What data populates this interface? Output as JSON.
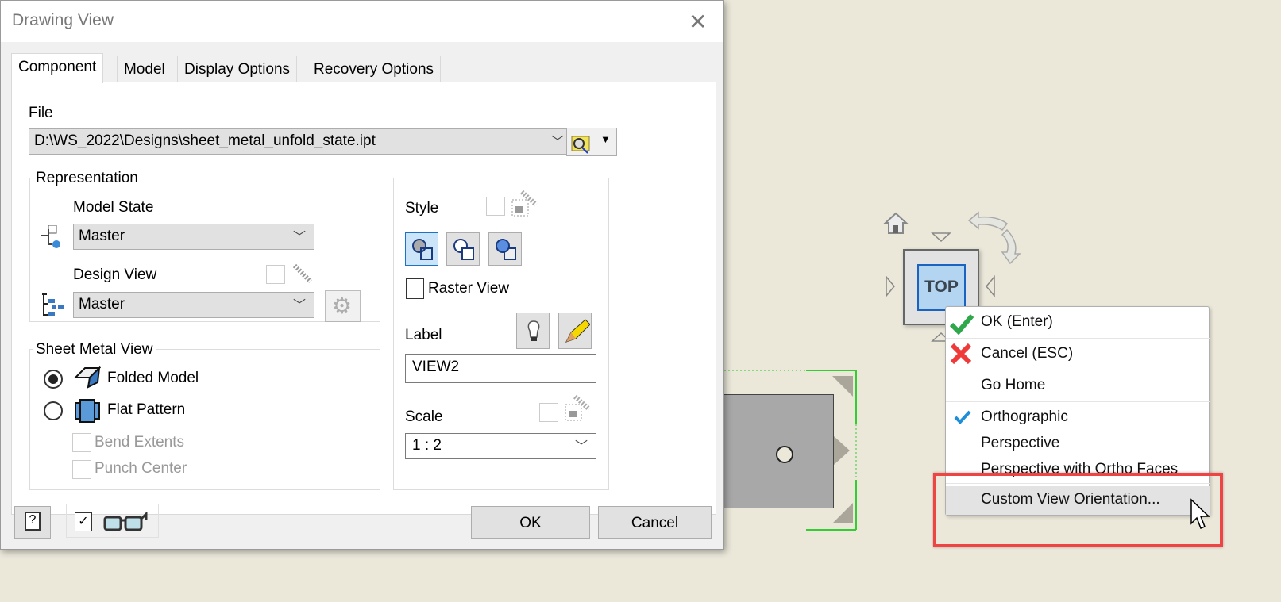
{
  "dialog": {
    "title": "Drawing View",
    "close": "✕",
    "tabs": [
      "Component",
      "Model",
      "Display Options",
      "Recovery Options"
    ],
    "file": {
      "label": "File",
      "value": "D:\\WS_2022\\Designs\\sheet_metal_unfold_state.ipt"
    },
    "representation": {
      "label": "Representation",
      "model_state_label": "Model State",
      "model_state_value": "Master",
      "design_view_label": "Design View",
      "design_view_value": "Master"
    },
    "sheet_metal": {
      "label": "Sheet Metal View",
      "folded": "Folded Model",
      "flat": "Flat Pattern",
      "bend": "Bend Extents",
      "punch": "Punch Center",
      "selected": "Folded Model"
    },
    "style": {
      "label": "Style",
      "raster": "Raster View",
      "label_label": "Label",
      "label_value": "VIEW2",
      "scale_label": "Scale",
      "scale_value": "1 : 2"
    },
    "buttons": {
      "ok": "OK",
      "cancel": "Cancel",
      "help": "?"
    }
  },
  "viewcube": {
    "face": "TOP"
  },
  "context_menu": {
    "items": [
      "OK (Enter)",
      "Cancel (ESC)",
      "Go Home",
      "Orthographic",
      "Perspective",
      "Perspective with Ortho Faces",
      "Custom View Orientation..."
    ],
    "checked": "Orthographic",
    "highlighted": "Custom View Orientation..."
  },
  "colors": {
    "canvas": "#ebe8da",
    "highlight_box": "#f04343",
    "ok_green": "#2ea84a",
    "cancel_red": "#f03a3a",
    "check_blue": "#1e8fd6"
  }
}
